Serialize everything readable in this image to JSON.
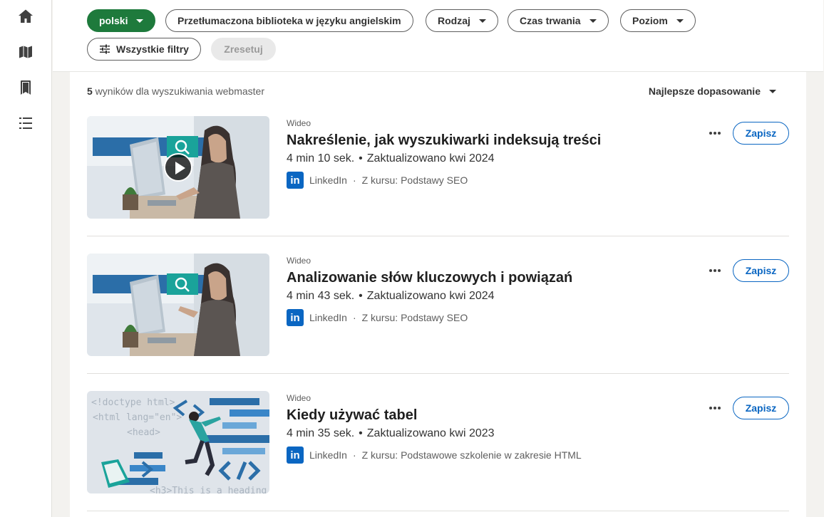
{
  "sidebar": {
    "items": [
      {
        "icon": "home-icon"
      },
      {
        "icon": "map-icon"
      },
      {
        "icon": "library-icon"
      },
      {
        "icon": "list-icon"
      }
    ]
  },
  "filters": {
    "language": "polski",
    "translated": "Przetłumaczona biblioteka w języku angielskim",
    "type": "Rodzaj",
    "duration": "Czas trwania",
    "level": "Poziom",
    "all_filters": "Wszystkie filtry",
    "reset": "Zresetuj"
  },
  "results": {
    "count": "5",
    "count_text": " wyników dla wyszukiwania webmaster",
    "sort": "Najlepsze dopasowanie",
    "items": [
      {
        "kind": "Wideo",
        "title": "Nakreślenie, jak wyszukiwarki indeksują treści",
        "duration": "4 min 10 sek.",
        "updated": "Zaktualizowano kwi 2024",
        "provider": "LinkedIn",
        "course": "Z kursu: Podstawy SEO",
        "save": "Zapisz"
      },
      {
        "kind": "Wideo",
        "title": "Analizowanie słów kluczowych i powiązań",
        "duration": "4 min 43 sek.",
        "updated": "Zaktualizowano kwi 2024",
        "provider": "LinkedIn",
        "course": "Z kursu: Podstawy SEO",
        "save": "Zapisz"
      },
      {
        "kind": "Wideo",
        "title": "Kiedy używać tabel",
        "duration": "4 min 35 sek.",
        "updated": "Zaktualizowano kwi 2023",
        "provider": "LinkedIn",
        "course": "Z kursu: Podstawowe szkolenie w zakresie HTML",
        "save": "Zapisz",
        "thumb_code": [
          "<!doctype html>",
          "<html lang=\"en\">",
          "<head>",
          "<h3>This is a heading"
        ]
      }
    ]
  },
  "colors": {
    "accent": "#0a66c2",
    "language_chip": "#1e7a3c"
  }
}
